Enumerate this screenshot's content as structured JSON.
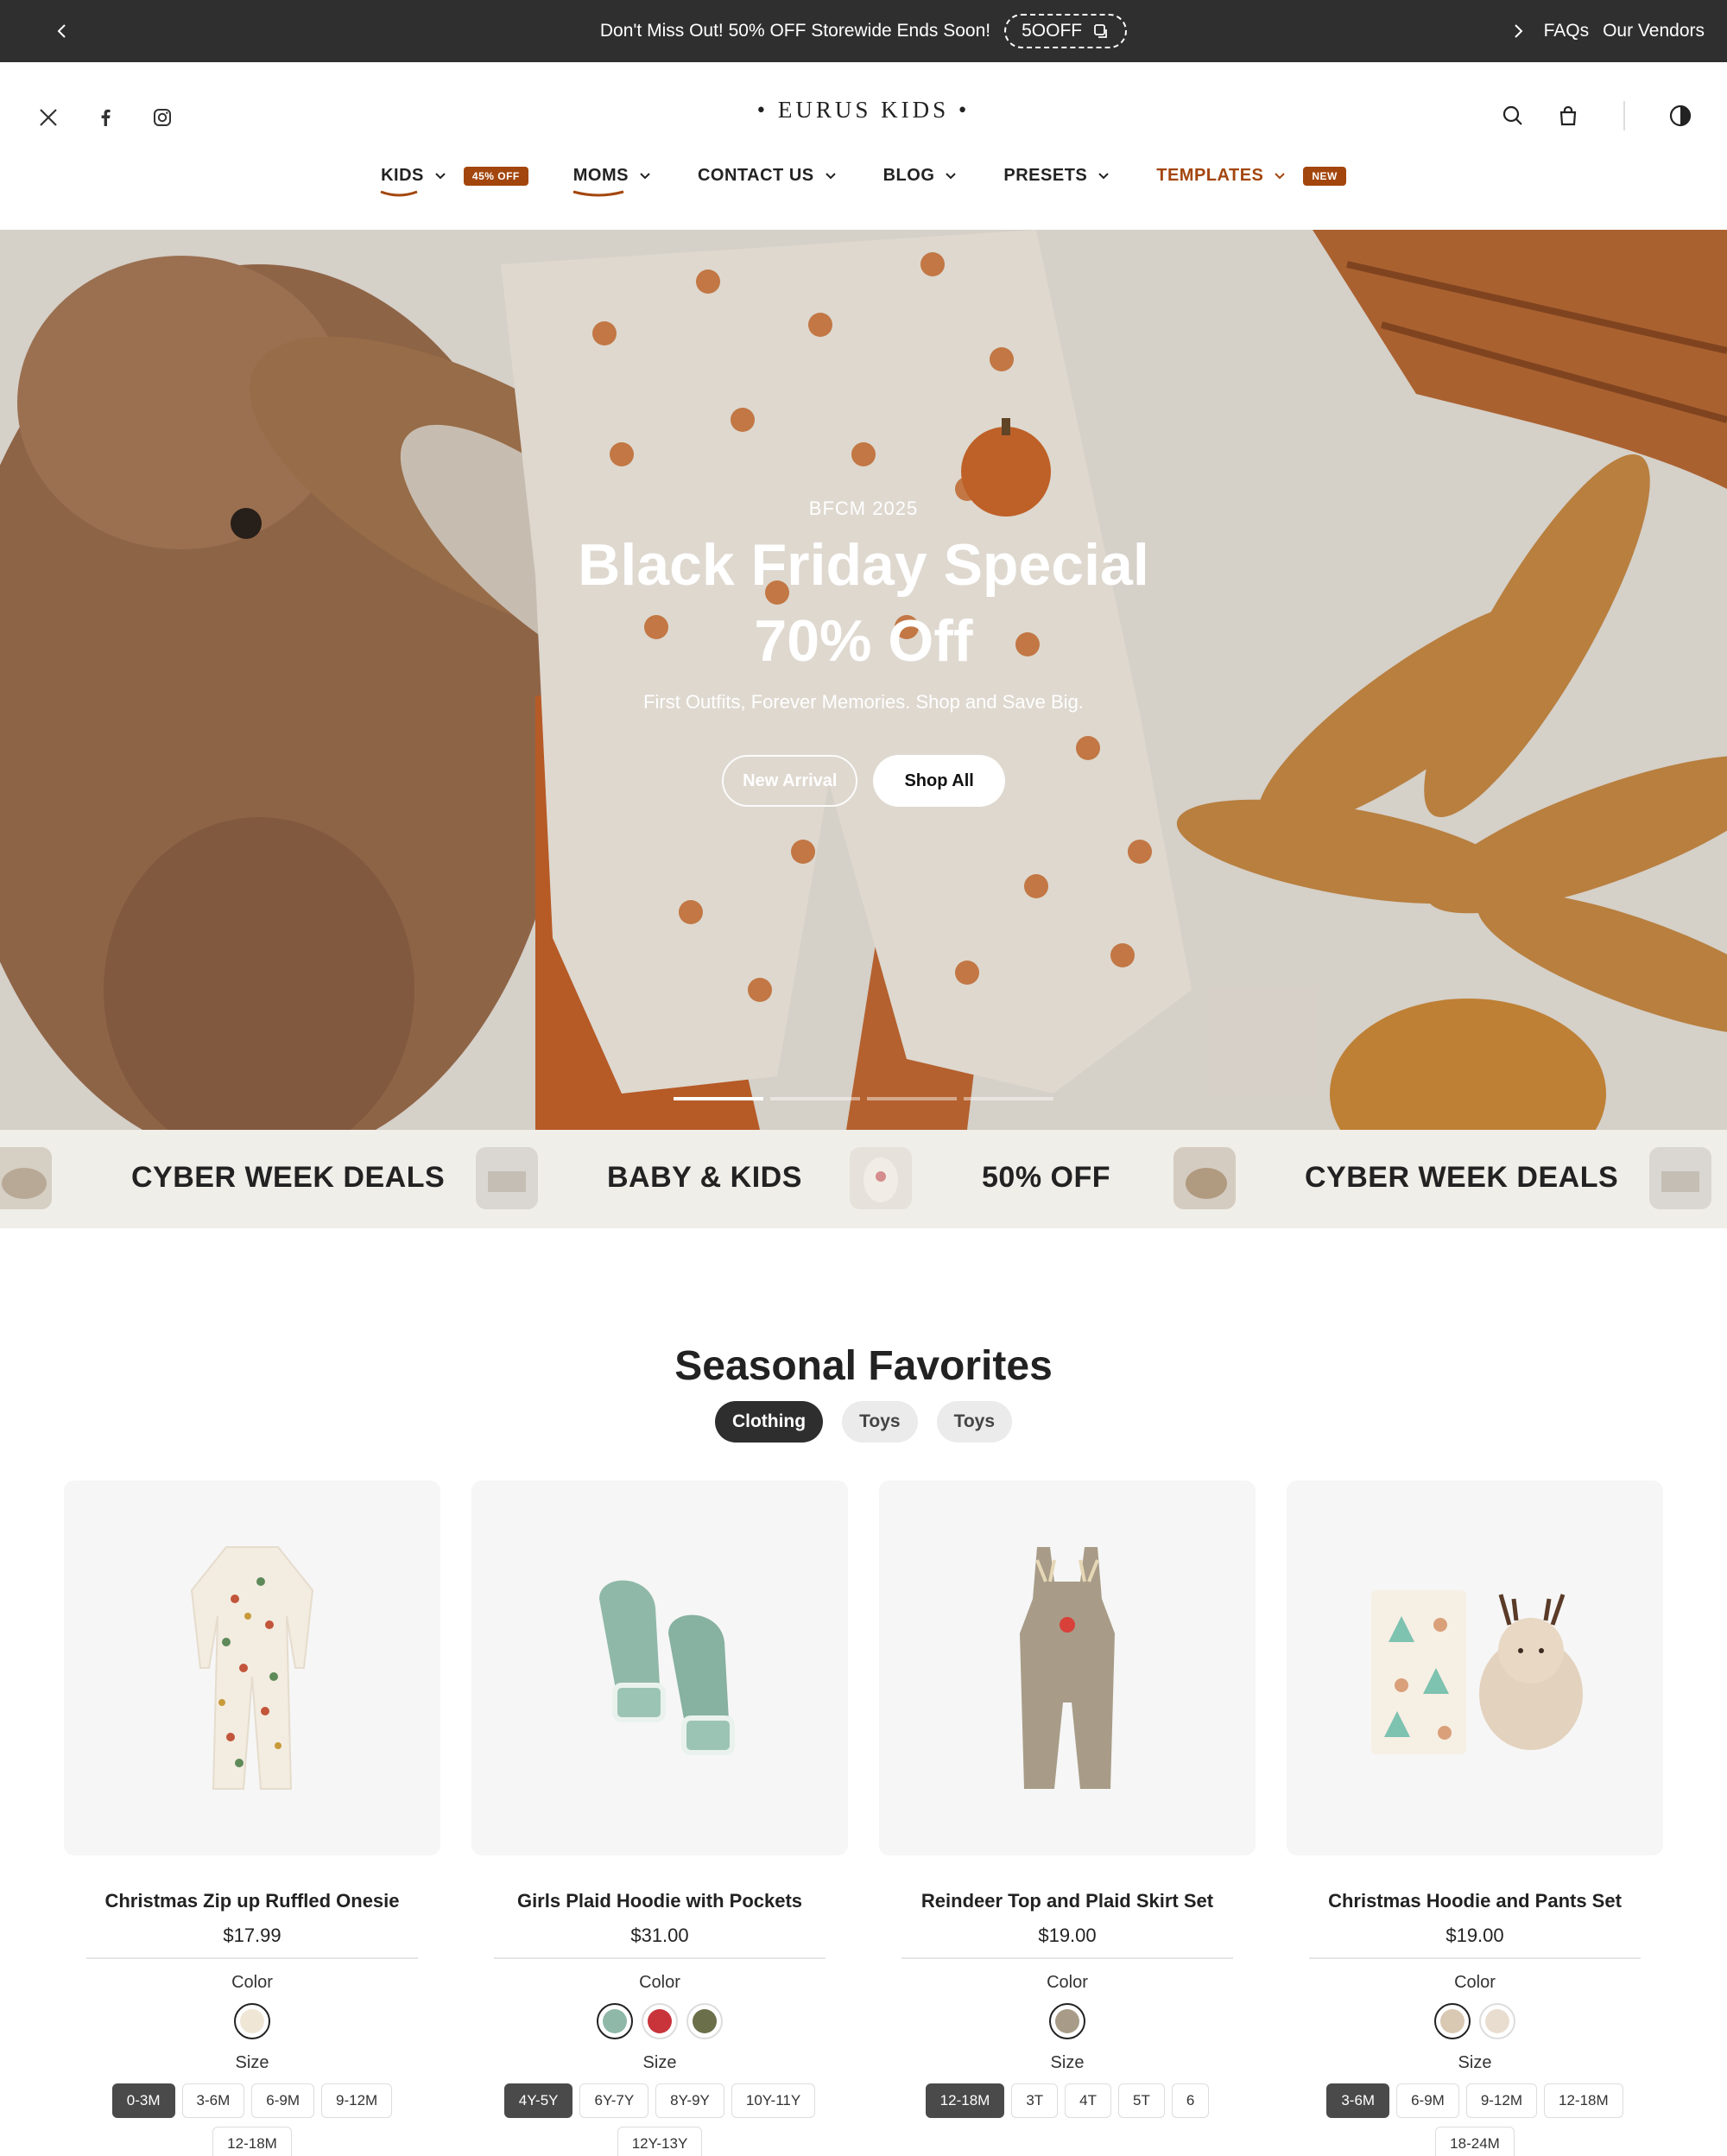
{
  "announcement": {
    "message": "Don't Miss Out! 50% OFF Storewide Ends Soon!",
    "code": "5OOFF",
    "links": [
      "FAQs",
      "Our Vendors"
    ]
  },
  "header": {
    "logo": "• EURUS KIDS •",
    "social_icons": [
      "x-icon",
      "facebook-icon",
      "instagram-icon"
    ],
    "nav": [
      {
        "label": "KIDS",
        "badge": "45% OFF"
      },
      {
        "label": "MOMS",
        "badge": ""
      },
      {
        "label": "CONTACT US",
        "badge": ""
      },
      {
        "label": "BLOG",
        "badge": ""
      },
      {
        "label": "PRESETS",
        "badge": ""
      },
      {
        "label": "TEMPLATES",
        "badge": "NEW"
      }
    ],
    "accent_color": "#a3460d"
  },
  "hero": {
    "eyebrow": "BFCM 2025",
    "title_line1": "Black Friday Special",
    "title_line2": "70% Off",
    "subtitle": "First Outfits, Forever Memories. Shop and Save Big.",
    "button_secondary": "New Arrival",
    "button_primary": "Shop All",
    "slides": 4,
    "active_slide": 1
  },
  "marquee": [
    "CYBER WEEK DEALS",
    "BABY & KIDS",
    "50% OFF",
    "CYBER WEEK DEALS"
  ],
  "seasonal": {
    "title": "Seasonal Favorites",
    "tabs": [
      "Clothing",
      "Toys",
      "Toys"
    ],
    "active_tab": 0,
    "color_label": "Color",
    "size_label": "Size",
    "products": [
      {
        "name": "Christmas Zip up Ruffled Onesie",
        "price": "$17.99",
        "colors": [
          "#efe6d6"
        ],
        "sizes": [
          "0-3M",
          "3-6M",
          "6-9M",
          "9-12M",
          "12-18M"
        ],
        "selected_size": 0
      },
      {
        "name": "Girls Plaid Hoodie with Pockets",
        "price": "$31.00",
        "colors": [
          "#8fb8a8",
          "#c8343a",
          "#6b6f4a"
        ],
        "sizes": [
          "4Y-5Y",
          "6Y-7Y",
          "8Y-9Y",
          "10Y-11Y",
          "12Y-13Y"
        ],
        "selected_size": 0
      },
      {
        "name": "Reindeer Top and Plaid Skirt Set",
        "price": "$19.00",
        "colors": [
          "#a89c88"
        ],
        "sizes": [
          "12-18M",
          "3T",
          "4T",
          "5T",
          "6"
        ],
        "selected_size": 0
      },
      {
        "name": "Christmas Hoodie and Pants Set",
        "price": "$19.00",
        "colors": [
          "#d9c8b2",
          "#e9ddd0"
        ],
        "sizes": [
          "3-6M",
          "6-9M",
          "9-12M",
          "12-18M",
          "18-24M"
        ],
        "selected_size": 0
      }
    ]
  }
}
